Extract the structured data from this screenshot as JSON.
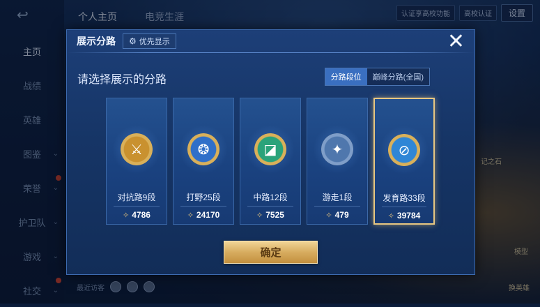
{
  "background": {
    "nav_items": [
      {
        "label": "主页",
        "active": true,
        "chevron": false,
        "dot": false
      },
      {
        "label": "战绩",
        "active": false,
        "chevron": false,
        "dot": false
      },
      {
        "label": "英雄",
        "active": false,
        "chevron": false,
        "dot": false
      },
      {
        "label": "图鉴",
        "active": false,
        "chevron": true,
        "dot": false
      },
      {
        "label": "荣誉",
        "active": false,
        "chevron": true,
        "dot": true
      },
      {
        "label": "护卫队",
        "active": false,
        "chevron": true,
        "dot": false
      },
      {
        "label": "游戏",
        "active": false,
        "chevron": true,
        "dot": false
      },
      {
        "label": "社交",
        "active": false,
        "chevron": true,
        "dot": true
      }
    ],
    "tabs": [
      "个人主页",
      "电竞生涯"
    ],
    "top_right": {
      "verify_text": "认证享高校功能",
      "campus_text": "高校认证",
      "settings_label": "设置"
    },
    "recent_visit_label": "最近访客",
    "side_texts": [
      "记之石",
      "模型",
      "换英雄"
    ]
  },
  "modal": {
    "title": "展示分路",
    "priority_label": "优先显示",
    "close_glyph": "✕",
    "prompt": "请选择展示的分路",
    "toggle": [
      {
        "label": "分路段位",
        "active": true
      },
      {
        "label": "巅峰分路(全国)",
        "active": false
      }
    ],
    "cards": [
      {
        "label": "对抗路9段",
        "score": "4786",
        "selected": false,
        "icon": "crossed-swords-emblem-icon",
        "ring": "#d9b05a",
        "fill": "#c9912f"
      },
      {
        "label": "打野25段",
        "score": "24170",
        "selected": false,
        "icon": "dragon-emblem-icon",
        "ring": "#d9b05a",
        "fill": "#2f6fc9"
      },
      {
        "label": "中路12段",
        "score": "7525",
        "selected": false,
        "icon": "mid-lane-emblem-icon",
        "ring": "#d9b05a",
        "fill": "#2aa37a"
      },
      {
        "label": "游走1段",
        "score": "479",
        "selected": false,
        "icon": "wings-emblem-icon",
        "ring": "#7f9ec9",
        "fill": "#4f77ad"
      },
      {
        "label": "发育路33段",
        "score": "39784",
        "selected": true,
        "icon": "bow-emblem-icon",
        "ring": "#d9b05a",
        "fill": "#2f86d6"
      }
    ],
    "confirm_label": "确定"
  }
}
